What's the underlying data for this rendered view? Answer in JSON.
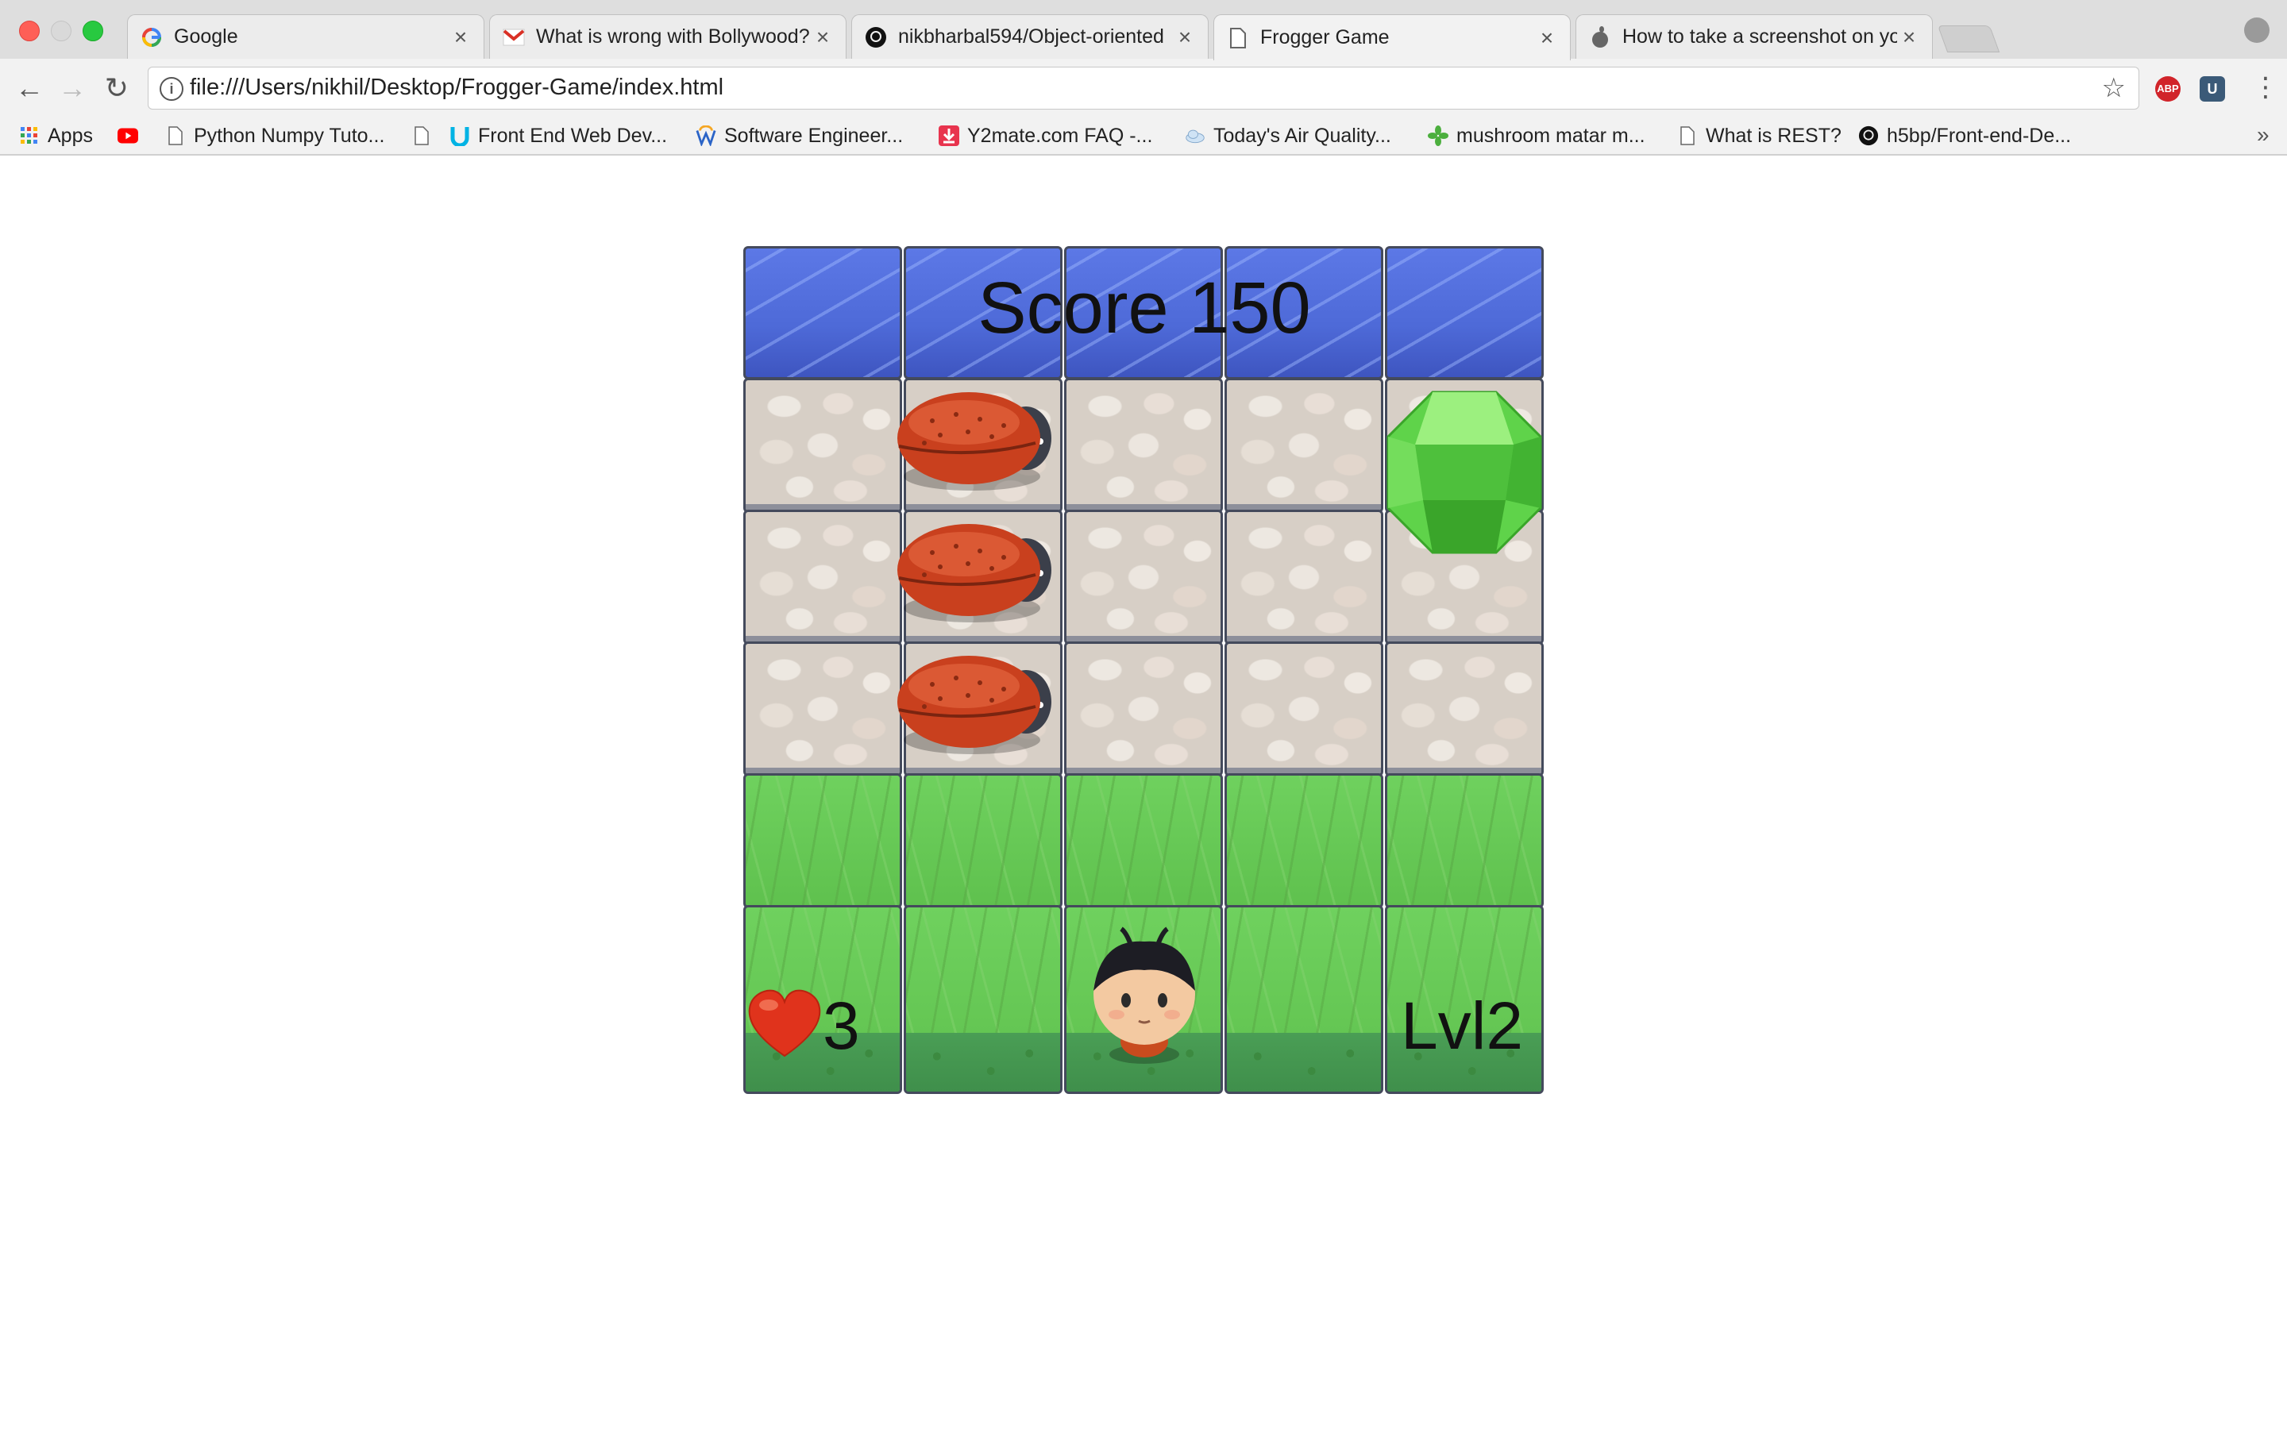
{
  "browser": {
    "tabs": [
      {
        "title": "Google",
        "icon": "google-icon",
        "active": false
      },
      {
        "title": "What is wrong with Bollywood?",
        "icon": "gmail-icon",
        "active": false
      },
      {
        "title": "nikbharbal594/Object-oriented",
        "icon": "github-icon",
        "active": false
      },
      {
        "title": "Frogger Game",
        "icon": "page-icon",
        "active": true
      },
      {
        "title": "How to take a screenshot on your",
        "icon": "apple-icon",
        "active": false
      }
    ],
    "close_glyph": "×",
    "url": "file:///Users/nikhil/Desktop/Frogger-Game/index.html",
    "info_glyph": "i",
    "star_glyph": "☆",
    "back_glyph": "←",
    "forward_glyph": "→",
    "reload_glyph": "↻",
    "menu_glyph": "⋮",
    "extensions": [
      {
        "name": "adblock-plus-icon",
        "label": "ABP",
        "color": "#d1242a"
      },
      {
        "name": "extension-u-icon",
        "label": "U",
        "color": "#3b5a78"
      }
    ]
  },
  "bookmarks": [
    {
      "label": "Apps",
      "icon": "apps-grid-icon"
    },
    {
      "label": "",
      "icon": "youtube-icon"
    },
    {
      "label": "Python Numpy Tuto...",
      "icon": "page-icon"
    },
    {
      "label": "",
      "icon": "page-icon"
    },
    {
      "label": "Front End Web Dev...",
      "icon": "udacity-icon"
    },
    {
      "label": "Software Engineer...",
      "icon": "w-icon"
    },
    {
      "label": "Y2mate.com FAQ -...",
      "icon": "download-icon"
    },
    {
      "label": "Today's Air Quality...",
      "icon": "cloud-icon"
    },
    {
      "label": "mushroom matar m...",
      "icon": "leaf-icon"
    },
    {
      "label": "What is REST?",
      "icon": "page-icon"
    },
    {
      "label": "h5bp/Front-end-De...",
      "icon": "github-icon"
    }
  ],
  "bookmarks_more_glyph": "»",
  "game": {
    "score_label": "Score 150",
    "lives": "3",
    "level_label": "Lvl2",
    "grid": {
      "columns": 5,
      "rows": [
        "water",
        "stone",
        "stone",
        "stone",
        "grass",
        "grass"
      ]
    },
    "enemies": [
      {
        "type": "bug",
        "row": 1,
        "col": 1
      },
      {
        "type": "bug",
        "row": 2,
        "col": 1
      },
      {
        "type": "bug",
        "row": 3,
        "col": 1
      }
    ],
    "gem": {
      "color": "green",
      "row": 1,
      "col": 4
    },
    "player": {
      "sprite": "boy",
      "row": 5,
      "col": 2
    },
    "heart_icon": "heart-icon",
    "colors": {
      "water": "#4e6ad8",
      "stone": "#d7cfc6",
      "grass": "#6fd15e",
      "bug": "#c9401e",
      "gem": "#5fd34a",
      "heart": "#e0331c"
    }
  }
}
